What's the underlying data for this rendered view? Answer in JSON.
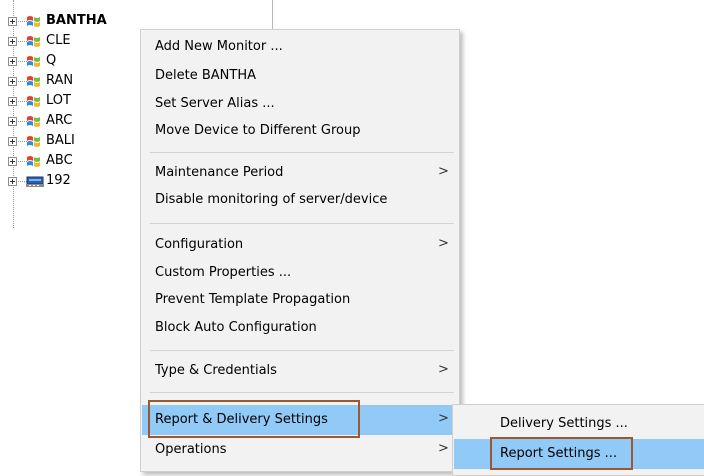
{
  "tree": {
    "nodes": [
      {
        "label": "BANTHA",
        "icon": "windows-server-icon",
        "bold": true
      },
      {
        "label": "CLE",
        "icon": "windows-server-icon"
      },
      {
        "label": "Q",
        "icon": "windows-server-icon"
      },
      {
        "label": "RAN",
        "icon": "windows-server-icon"
      },
      {
        "label": "LOT",
        "icon": "windows-server-icon"
      },
      {
        "label": "ARC",
        "icon": "windows-server-icon"
      },
      {
        "label": "BALI",
        "icon": "windows-server-icon"
      },
      {
        "label": "ABC",
        "icon": "windows-server-icon"
      },
      {
        "label": "192",
        "icon": "network-device-icon"
      }
    ]
  },
  "context_menu": {
    "items": [
      {
        "label": "Add New Monitor ..."
      },
      {
        "label": "Delete BANTHA"
      },
      {
        "label": "Set Server Alias ..."
      },
      {
        "label": "Move Device to Different Group"
      },
      {
        "label": "Maintenance Period",
        "submenu_arrow": ">"
      },
      {
        "label": "Disable monitoring of server/device"
      },
      {
        "label": "Configuration",
        "submenu_arrow": ">"
      },
      {
        "label": "Custom Properties ..."
      },
      {
        "label": "Prevent Template Propagation"
      },
      {
        "label": "Block Auto Configuration"
      },
      {
        "label": "Type & Credentials",
        "submenu_arrow": ">"
      },
      {
        "label": "Report & Delivery Settings",
        "submenu_arrow": ">",
        "highlighted": true
      },
      {
        "label": "Operations",
        "submenu_arrow": ">"
      }
    ]
  },
  "submenu": {
    "items": [
      {
        "label": "Delivery Settings ..."
      },
      {
        "label": "Report Settings ...",
        "highlighted": true
      }
    ]
  },
  "colors": {
    "menu_background": "#f2f2f2",
    "highlight": "#91c9f7",
    "annotation_box": "#9a5a31"
  }
}
